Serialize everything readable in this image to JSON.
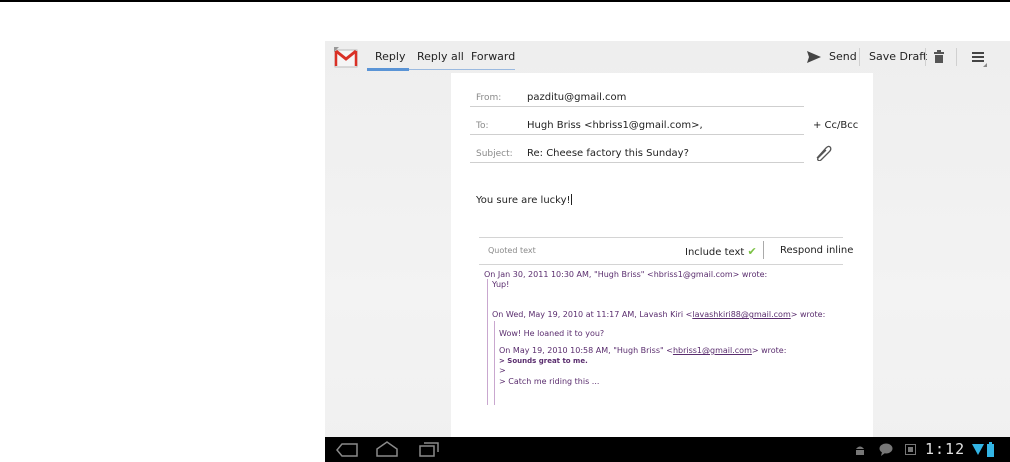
{
  "tabs": {
    "reply": "Reply",
    "reply_all": "Reply all",
    "forward": "Forward"
  },
  "actions": {
    "send": "Send",
    "save_draft": "Save Draft"
  },
  "compose": {
    "from_label": "From:",
    "from_value": "pazditu@gmail.com",
    "to_label": "To:",
    "to_value": "Hugh Briss <hbriss1@gmail.com>,",
    "ccbcc": "+ Cc/Bcc",
    "subject_label": "Subject:",
    "subject_value": "Re: Cheese factory this Sunday?",
    "body": "You sure are lucky!"
  },
  "quoted": {
    "label": "Quoted text",
    "include_text": "Include text",
    "respond_inline": "Respond inline",
    "line1": "On Jan 30, 2011 10:30 AM, \"Hugh Briss\" <hbriss1@gmail.com> wrote:",
    "line2": "Yup!",
    "line3_pre": "On Wed, May 19, 2010 at 11:17 AM, Lavash Kiri <",
    "line3_link": "lavashkiri88@gmail.com",
    "line3_post": "> wrote:",
    "line4": "Wow! He loaned it to you?",
    "line5_pre": "On May 19, 2010 10:58 AM, \"Hugh Briss\" <",
    "line5_link": "hbriss1@gmail.com",
    "line5_post": "> wrote:",
    "line6": "> Sounds great to me.",
    "line7": ">",
    "line8": "> Catch me riding this ..."
  },
  "status": {
    "clock": "1:12"
  },
  "colors": {
    "accent": "#5a94d6",
    "quoted_text": "#5a2d6e",
    "check": "#7ac143"
  }
}
